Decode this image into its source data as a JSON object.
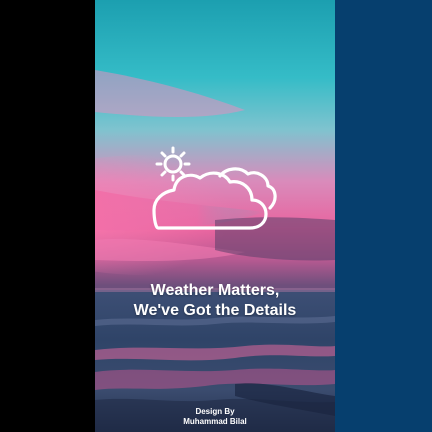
{
  "splash": {
    "headline_line1": "Weather Matters,",
    "headline_line2": "We've Got the Details",
    "credit_line1": "Design By",
    "credit_line2": "Muhammad Bilal",
    "logo_icon": "cloud-sun-icon"
  },
  "colors": {
    "left_band": "#000000",
    "right_band": "#063f6e",
    "sky_top": "#1fa3b3",
    "sky_pink": "#e86aa6",
    "sea": "#2a3d5e",
    "text": "#ffffff"
  }
}
